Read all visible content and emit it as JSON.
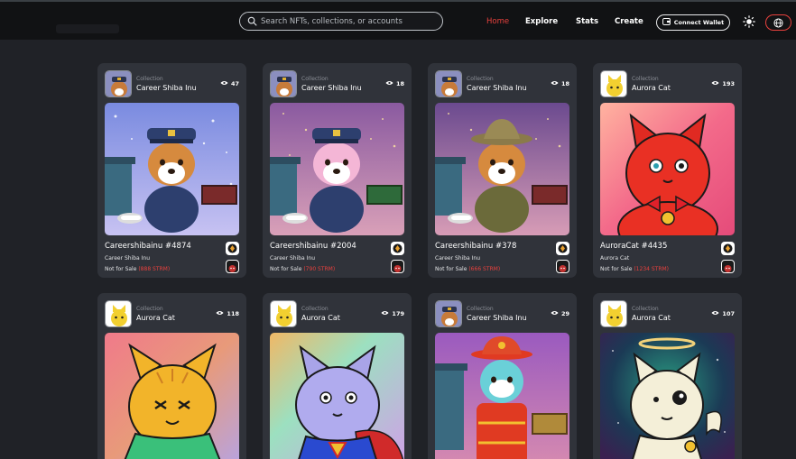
{
  "navbar": {
    "search_placeholder": "Search NFTs, collections, or accounts",
    "links": [
      "Home",
      "Explore",
      "Stats",
      "Create"
    ],
    "active_link": "Home",
    "connect_label": "Connect Wallet",
    "accent_color": "#e8413d"
  },
  "cards": [
    {
      "collection_caption": "Collection",
      "collection_name": "Career Shiba Inu",
      "views": "47",
      "title": "Careershibainu #4874",
      "collection_line": "Career Shiba Inu",
      "sale_label": "Not for Sale",
      "price": "(888 STRM)",
      "art": "shiba-police"
    },
    {
      "collection_caption": "Collection",
      "collection_name": "Career Shiba Inu",
      "views": "18",
      "title": "Careershibainu #2004",
      "collection_line": "Career Shiba Inu",
      "sale_label": "Not for Sale",
      "price": "(790 STRM)",
      "art": "shiba-police-pink"
    },
    {
      "collection_caption": "Collection",
      "collection_name": "Career Shiba Inu",
      "views": "18",
      "title": "Careershibainu #378",
      "collection_line": "Career Shiba Inu",
      "sale_label": "Not for Sale",
      "price": "(666 STRM)",
      "art": "shiba-ranger"
    },
    {
      "collection_caption": "Collection",
      "collection_name": "Aurora Cat",
      "views": "193",
      "title": "AuroraCat #4435",
      "collection_line": "Aurora Cat",
      "sale_label": "Not for Sale",
      "price": "(1234 STRM)",
      "art": "cat-red"
    },
    {
      "collection_caption": "Collection",
      "collection_name": "Aurora Cat",
      "views": "118",
      "art": "cat-yellow"
    },
    {
      "collection_caption": "Collection",
      "collection_name": "Aurora Cat",
      "views": "179",
      "art": "cat-super"
    },
    {
      "collection_caption": "Collection",
      "collection_name": "Career Shiba Inu",
      "views": "29",
      "art": "shiba-fire"
    },
    {
      "collection_caption": "Collection",
      "collection_name": "Aurora Cat",
      "views": "107",
      "art": "cat-angel"
    }
  ]
}
